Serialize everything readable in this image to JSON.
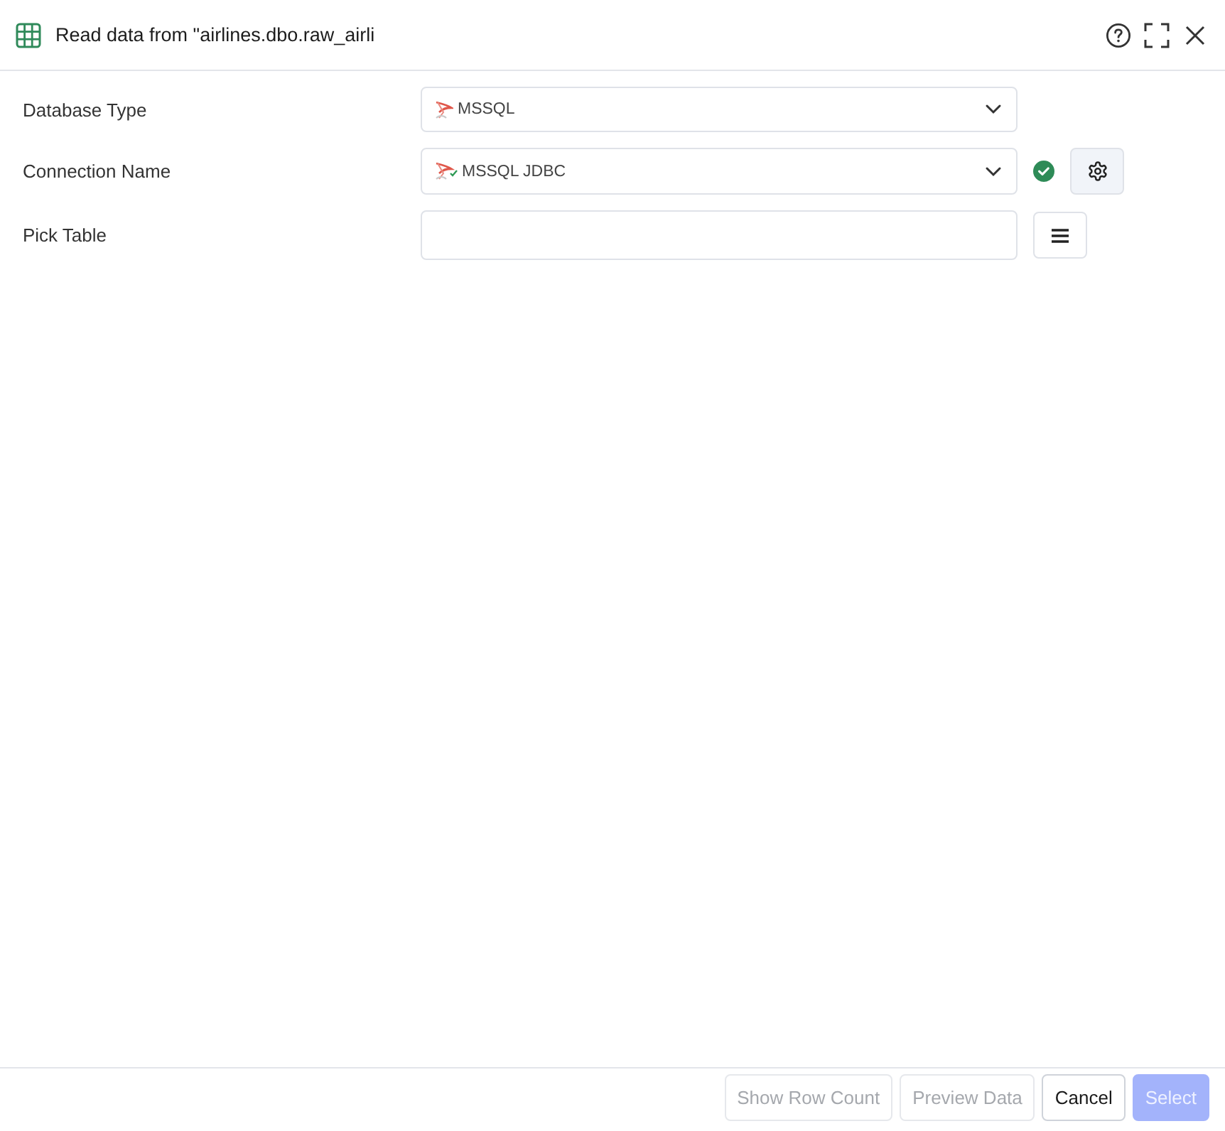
{
  "dialog": {
    "title": "Read data from \"airlines.dbo.raw_airli"
  },
  "fields": [
    {
      "label": "Database Type",
      "kind": "select",
      "value": "MSSQL"
    },
    {
      "label": "Connection Name",
      "kind": "connection",
      "value": "MSSQL JDBC",
      "verified": true
    },
    {
      "label": "Pick Table",
      "kind": "table"
    }
  ],
  "buttons": [
    {
      "label": "Show Row Count",
      "kind": "secondary",
      "disabled": true
    },
    {
      "label": "Preview Data",
      "kind": "secondary",
      "disabled": true
    },
    {
      "label": "Cancel",
      "kind": "secondary",
      "disabled": false
    },
    {
      "label": "Select",
      "kind": "primary",
      "disabled": true
    }
  ]
}
